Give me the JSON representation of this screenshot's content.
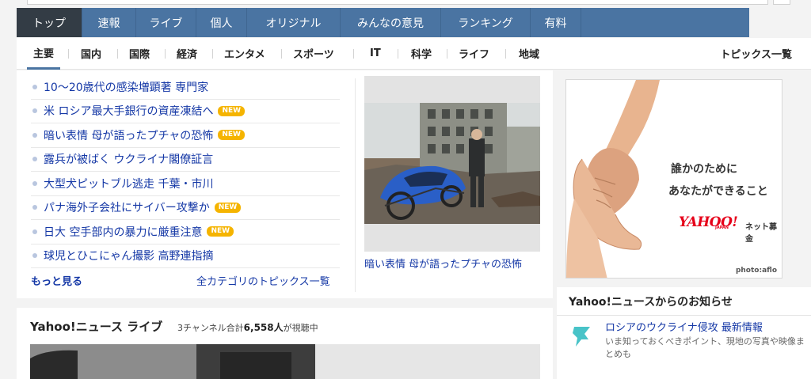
{
  "main_nav": {
    "tabs": [
      {
        "label": "トップ",
        "active": true
      },
      {
        "label": "速報"
      },
      {
        "label": "ライブ"
      },
      {
        "label": "個人"
      },
      {
        "label": "オリジナル"
      },
      {
        "label": "みんなの意見"
      },
      {
        "label": "ランキング"
      },
      {
        "label": "有料"
      }
    ]
  },
  "sub_nav": {
    "items": [
      {
        "label": "主要",
        "active": true
      },
      {
        "label": "国内"
      },
      {
        "label": "国際"
      },
      {
        "label": "経済"
      },
      {
        "label": "エンタメ"
      },
      {
        "label": "スポーツ"
      },
      {
        "label": "IT"
      },
      {
        "label": "科学"
      },
      {
        "label": "ライフ"
      },
      {
        "label": "地域"
      }
    ],
    "all_topics": "トピックス一覧"
  },
  "topics": {
    "headlines": [
      {
        "text": "10～20歳代の感染増顕著 専門家",
        "new": false
      },
      {
        "text": "米 ロシア最大手銀行の資産凍結へ",
        "new": true
      },
      {
        "text": "暗い表情 母が語ったプチャの恐怖",
        "new": true
      },
      {
        "text": "露兵が被ばく ウクライナ閣僚証言",
        "new": false
      },
      {
        "text": "大型犬ピットブル逃走 千葉・市川",
        "new": false
      },
      {
        "text": "パナ海外子会社にサイバー攻撃か",
        "new": true
      },
      {
        "text": "日大 空手部内の暴力に厳重注意",
        "new": true
      },
      {
        "text": "球児とひこにゃん撮影 高野連指摘",
        "new": false
      }
    ],
    "new_badge": "NEW",
    "more": "もっと見る",
    "all_categories": "全カテゴリのトピックス一覧",
    "photo_caption": "暗い表情 母が語ったプチャの恐怖"
  },
  "live": {
    "title": "Yahoo!ニュース ライブ",
    "viewers_prefix": "3チャンネル合計",
    "viewers_count": "6,558人",
    "viewers_suffix": "が視聴中"
  },
  "ad": {
    "line1": "誰かのために",
    "line2": "あなたができること",
    "logo": "YAHOO!",
    "logo_sub": "JAPAN",
    "service": "ネット募金",
    "credit": "photo:aflo"
  },
  "notice": {
    "heading": "Yahoo!ニュースからのお知らせ",
    "title": "ロシアのウクライナ侵攻 最新情報",
    "description": "いま知っておくべきポイント、現地の写真や映像まとめも"
  },
  "colors": {
    "nav_blue": "#4a74a2",
    "nav_active": "#333c45",
    "link": "#1538a6",
    "new_badge": "#f5b400",
    "yahoo_red": "#e60019"
  }
}
